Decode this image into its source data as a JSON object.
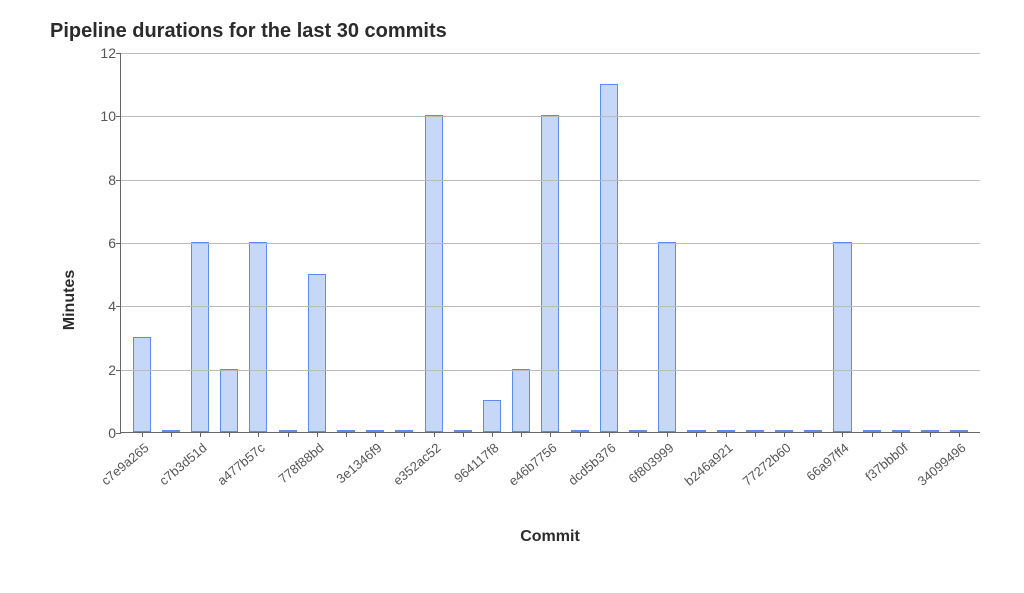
{
  "chart_data": {
    "type": "bar",
    "title": "Pipeline durations for the last 30 commits",
    "xlabel": "Commit",
    "ylabel": "Minutes",
    "ylim": [
      0,
      12
    ],
    "yticks": [
      0,
      2,
      4,
      6,
      8,
      10,
      12
    ],
    "categories": [
      "c7e9a265",
      "",
      "c7b3d51d",
      "",
      "a477b57c",
      "",
      "778f88bd",
      "",
      "3e1346f9",
      "",
      "e352ac52",
      "",
      "964117f8",
      "",
      "e46b7756",
      "",
      "dcd5b376",
      "",
      "6f803999",
      "",
      "b246a921",
      "",
      "77272b60",
      "",
      "66a97ff4",
      "",
      "f37bbb0f",
      "",
      "34099496"
    ],
    "values": [
      3,
      0,
      6,
      2,
      6,
      0,
      5,
      0,
      0,
      0,
      10,
      0,
      1,
      2,
      10,
      0,
      11,
      0,
      6,
      0,
      0,
      0,
      0,
      0,
      6,
      0,
      0,
      0,
      0
    ]
  }
}
